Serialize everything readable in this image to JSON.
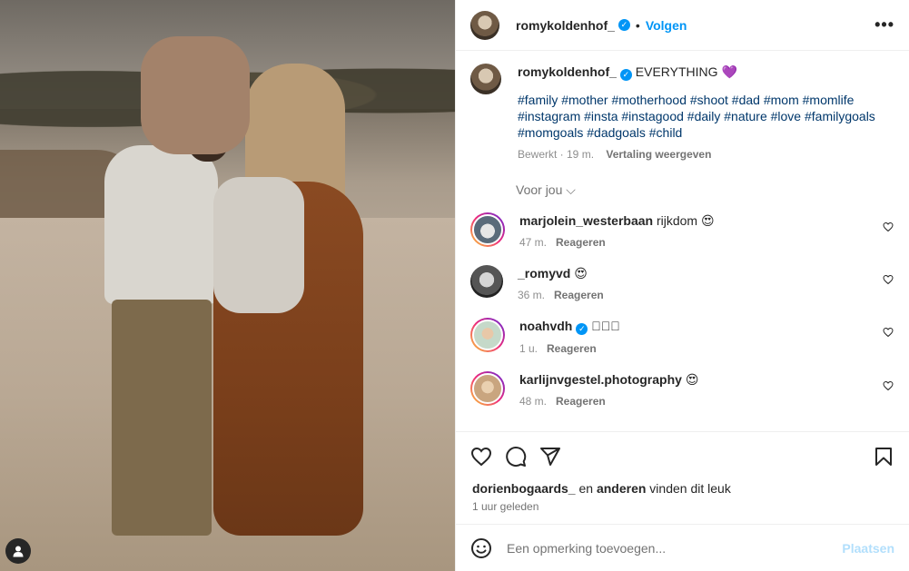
{
  "post": {
    "author": "romykoldenhof_",
    "follow_label": "Volgen",
    "separator": "•",
    "more_label": "•••"
  },
  "caption": {
    "author": "romykoldenhof_",
    "text": "EVERYTHING 💜",
    "hashtags": "#family #mother #motherhood #shoot #dad #mom #momlife #instagram #insta #instagood #daily #nature #love #familygoals #momgoals #dadgoals #child",
    "meta_edited": "Bewerkt · 19 m.",
    "meta_translate": "Vertaling weergeven"
  },
  "for_you_label": "Voor jou ⌵",
  "comments": [
    {
      "username": "marjolein_westerbaan",
      "text": "rijkdom 😍",
      "time": "47 m.",
      "reply": "Reageren",
      "verified": false
    },
    {
      "username": "_romyvd",
      "text": "😍",
      "time": "36 m.",
      "reply": "Reageren",
      "verified": false
    },
    {
      "username": "noahvdh",
      "text": "🏽🏽🏽",
      "time": "1 u.",
      "reply": "Reageren",
      "verified": true
    },
    {
      "username": "karlijnvgestel.photography",
      "text": "😍",
      "time": "48 m.",
      "reply": "Reageren",
      "verified": false
    }
  ],
  "likes": {
    "user": "dorienbogaards_",
    "middle": " en ",
    "others": "anderen",
    "suffix": " vinden dit leuk"
  },
  "posted_time": "1 uur geleden",
  "add_comment": {
    "placeholder": "Een opmerking toevoegen...",
    "post_label": "Plaatsen"
  },
  "icons": {
    "verified": "✓",
    "like": "heart-icon",
    "comment": "comment-icon",
    "share": "share-icon",
    "save": "bookmark-icon",
    "emoji": "emoji-icon"
  },
  "colors": {
    "accent": "#0095f6",
    "hashtag": "#00376b",
    "post_disabled": "#b2dffc"
  }
}
